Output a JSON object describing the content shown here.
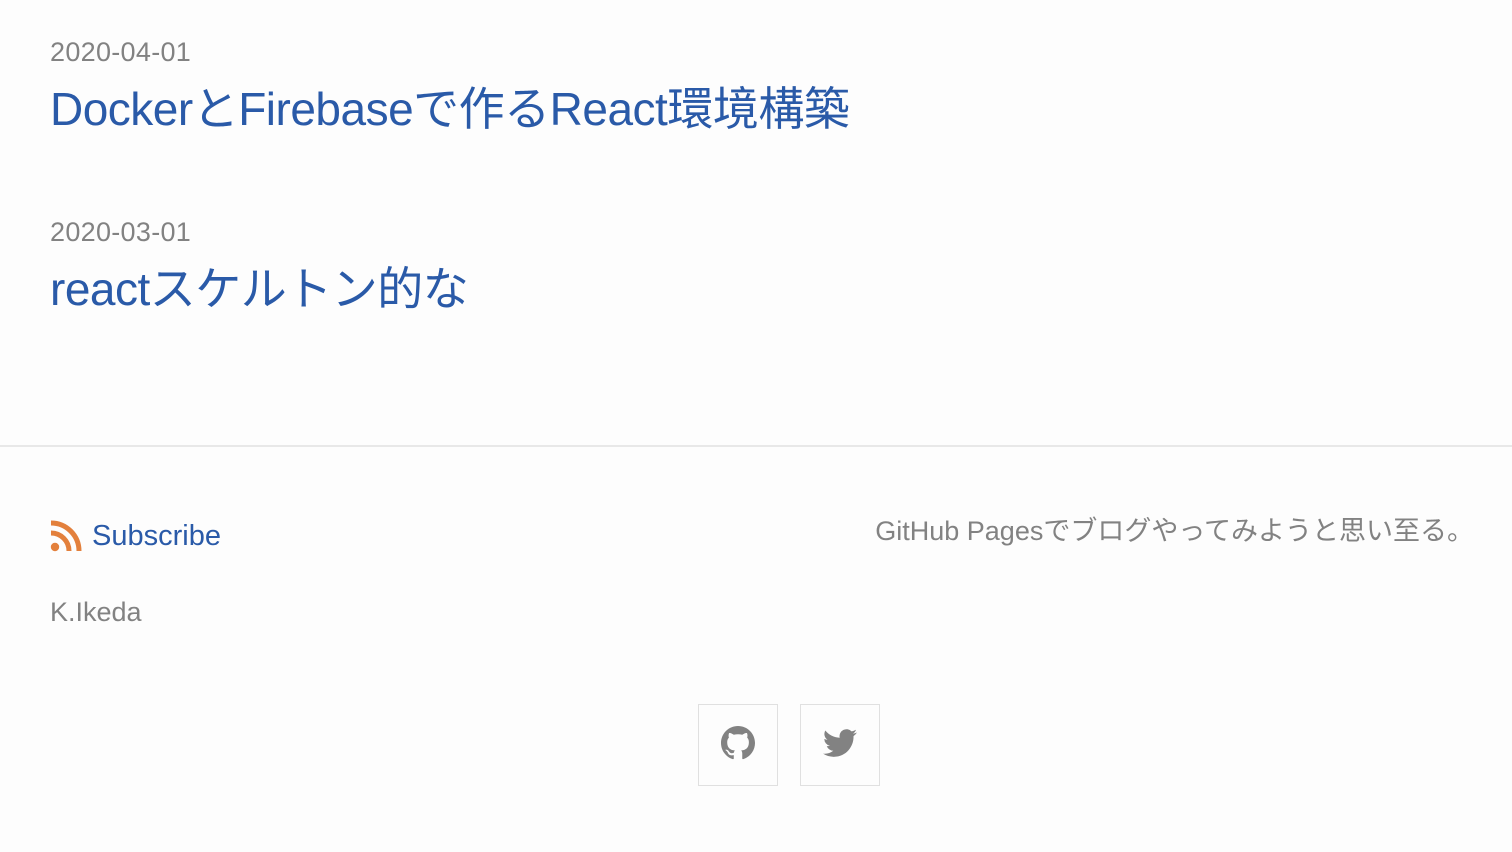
{
  "posts": [
    {
      "date": "2020-04-01",
      "title": "DockerとFirebaseで作るReact環境構築"
    },
    {
      "date": "2020-03-01",
      "title": "reactスケルトン的な"
    }
  ],
  "footer": {
    "subscribe_label": "Subscribe",
    "subscribe_icon": "rss-icon",
    "author": "K.Ikeda",
    "tagline": "GitHub Pagesでブログやってみようと思い至る。",
    "social": [
      {
        "icon": "github-icon"
      },
      {
        "icon": "twitter-icon"
      }
    ]
  },
  "colors": {
    "link": "#2a5aa8",
    "meta_text": "#828282",
    "rss": "#e3803c",
    "icon": "#828282",
    "background": "#fdfdfd"
  }
}
